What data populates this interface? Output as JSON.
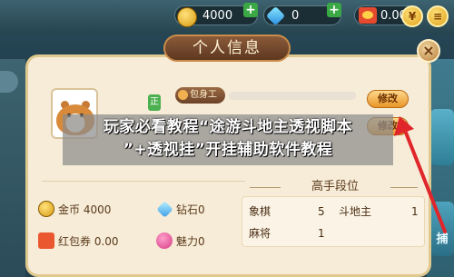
{
  "topbar": {
    "coins": "4000",
    "coins_icon": "coin-icon",
    "diamonds": "0",
    "diamonds_icon": "diamond-icon",
    "add_label": "+",
    "envelope_icon": "red-envelope-icon",
    "redpack_value": "0.00",
    "buttons": [
      "¥",
      "≡"
    ]
  },
  "panel": {
    "title": "个人信息",
    "close_label": "×",
    "verified_badge": "正",
    "id_label": "包身工",
    "edit_label_1": "修改",
    "edit_label_2": "修改",
    "overlay_text_line1": "玩家必看教程“途游斗地主透视脚本",
    "overlay_text_line2": "”+透视挂”开挂辅助软件教程"
  },
  "stats": [
    {
      "icon": "coin-icon",
      "label": "金币 4000"
    },
    {
      "icon": "diamond-icon",
      "label": "钻石0"
    },
    {
      "icon": "red-envelope-icon",
      "label": "红包券 0.00"
    },
    {
      "icon": "heart-icon",
      "label": "魅力0"
    }
  ],
  "ranking": {
    "title": "高手段位",
    "rows": [
      {
        "game": "象棋",
        "value": "5",
        "game2": "斗地主",
        "value2": "1"
      },
      {
        "game": "麻将",
        "value": "1"
      }
    ]
  },
  "side": {
    "right_tile_2": "捕"
  },
  "colors": {
    "panel_bg": "#f6ecd7",
    "accent_orange": "#e9962a",
    "arrow_red": "#e0262a"
  }
}
